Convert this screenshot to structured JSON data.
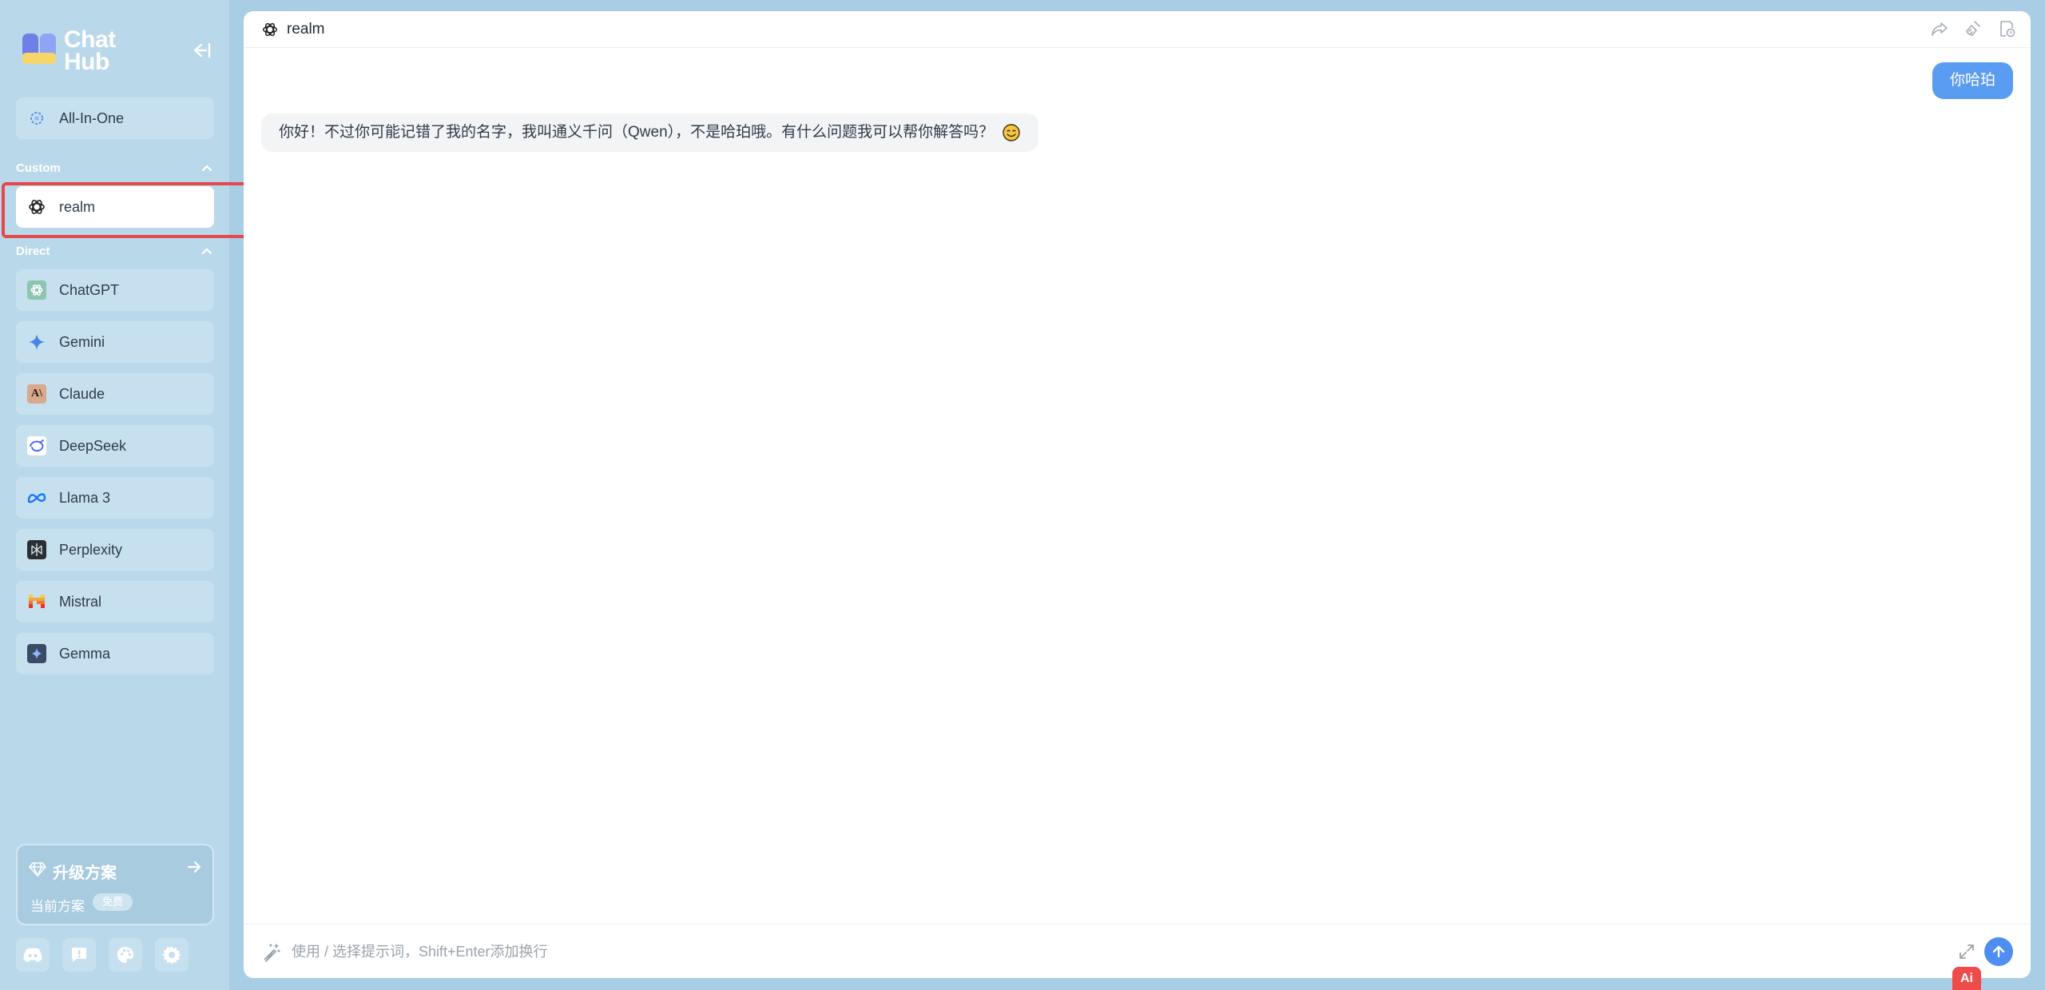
{
  "app": {
    "logo_line1": "Chat",
    "logo_line2": "Hub"
  },
  "sidebar": {
    "all_in_one": "All-In-One",
    "custom_section": "Custom",
    "custom_items": [
      {
        "label": "realm",
        "icon": "openai-icon",
        "active": true
      }
    ],
    "direct_section": "Direct",
    "direct_items": [
      {
        "label": "ChatGPT",
        "icon": "chatgpt-icon"
      },
      {
        "label": "Gemini",
        "icon": "gemini-icon"
      },
      {
        "label": "Claude",
        "icon": "claude-icon"
      },
      {
        "label": "DeepSeek",
        "icon": "deepseek-icon"
      },
      {
        "label": "Llama 3",
        "icon": "meta-icon"
      },
      {
        "label": "Perplexity",
        "icon": "perplexity-icon"
      },
      {
        "label": "Mistral",
        "icon": "mistral-icon"
      },
      {
        "label": "Gemma",
        "icon": "gemma-icon"
      }
    ],
    "upgrade": {
      "title": "升级方案",
      "plan_label": "当前方案",
      "plan_badge": "免费"
    },
    "bottom_icons": [
      "discord-icon",
      "feedback-icon",
      "theme-icon",
      "settings-icon"
    ]
  },
  "chat": {
    "title": "realm",
    "messages": [
      {
        "role": "user",
        "text": "你哈珀"
      },
      {
        "role": "assistant",
        "text": "你好！不过你可能记错了我的名字，我叫通义千问（Qwen），不是哈珀哦。有什么问题我可以帮你解答吗？"
      }
    ],
    "composer_placeholder": "使用 / 选择提示词，Shift+Enter添加换行",
    "float_badge": "Ai"
  },
  "colors": {
    "page_bg": "#a9cde4",
    "sidebar_bg": "#b9d8ea",
    "accent": "#5b9cf3",
    "highlight": "#e5484d"
  }
}
